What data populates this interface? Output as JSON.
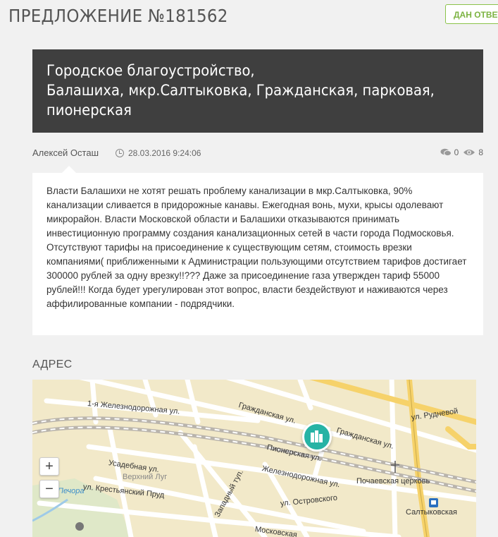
{
  "header": {
    "title": "ПРЕДЛОЖЕНИЕ №181562",
    "status_badge": "ДАН ОТВЕТ"
  },
  "proposal": {
    "title_lines": [
      "Городское благоустройство,",
      "Балашиха, мкр.Салтыковка, Гражданская, парковая,",
      "пионерская"
    ],
    "author": "Алексей Осташ",
    "date": "28.03.2016 9:24:06",
    "comments_count": "0",
    "views_count": "8",
    "body": "Власти Балашихи не хотят решать проблему канализации в мкр.Салтыковка, 90% канализации сливается в придорожные канавы. Ежегодная вонь, мухи, крысы одолевают микрорайон. Власти Московской области и Балашихи отказываются принимать инвестиционную программу создания канализационных сетей в части города Подмосковья. Отсутствуют тарифы на присоединение к существующим сетям, стоимость врезки компаниями( приближенными к Администрации пользующими отсутствием тарифов достигает 300000 рублей за одну врезку!!??? Даже за присоединение газа утвержден тариф 55000 рублей!!! Когда будет урегулирован этот вопрос, власти бездействуют и наживаются через аффилированные компании - подрядчики."
  },
  "address": {
    "heading": "АДРЕС",
    "map": {
      "zoom_in": "+",
      "zoom_out": "−",
      "labels": {
        "zheleznodorozhnaya1": "1-я Железнодорожная ул.",
        "grazhdanskaya_top": "Гражданская ул.",
        "grazhdanskaya_right": "Гражданская ул.",
        "rudnevoy": "ул. Рудневой",
        "pionerskaya": "Пионерская ул.",
        "usadebnaya": "Усадебная ул.",
        "zheleznodorozhnaya": "Железнодорожная ул.",
        "verkhniy_lug": "Верхний Луг",
        "krestyansky": "ул. Крестьянский Пруд",
        "zapadny": "Западный туп.",
        "ostrovskogo": "ул. Островского",
        "pochaevskaya": "Почаевская церковь",
        "saltykovskaya": "Салтыковская",
        "moskovskaya": "Московская",
        "pechora": "Печора"
      }
    }
  }
}
